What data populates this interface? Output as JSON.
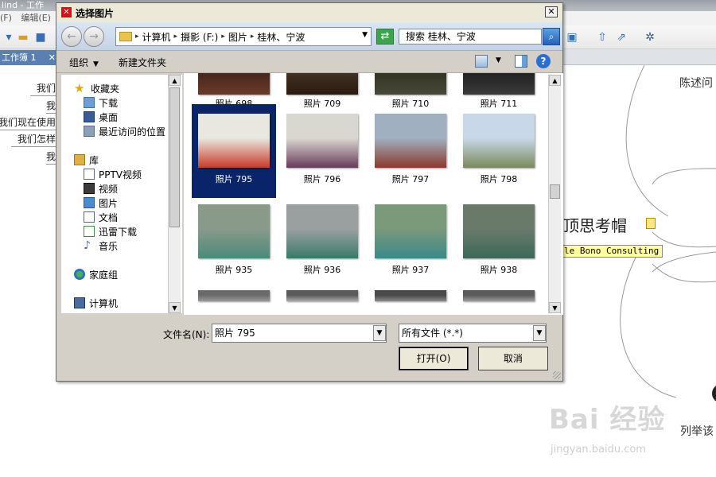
{
  "background_app": {
    "title": "lind - 工作",
    "menu": [
      "(F)",
      "编辑(E)"
    ],
    "tab_label": "工作簿 1",
    "left_topics": [
      "我们",
      "我",
      "我们现在使用",
      "我们怎样",
      "我"
    ],
    "right_topic_top": "陈述问",
    "central_topic": "顶思考帽",
    "tooltip": "le Bono Consulting",
    "right_topic_bottom": "列举该"
  },
  "watermark": {
    "brand": "Bai 经验",
    "url": "jingyan.baidu.com"
  },
  "dialog": {
    "title": "选择图片",
    "close_glyph": "✕",
    "address": {
      "segments": [
        "计算机",
        "摄影 (F:)",
        "图片",
        "桂林、宁波"
      ]
    },
    "search": {
      "placeholder": "搜索 桂林、宁波"
    },
    "commands": {
      "organize": "组织",
      "new_folder": "新建文件夹",
      "help_glyph": "?"
    },
    "nav_pane": {
      "favorites_header": "收藏夹",
      "favorites": [
        "下载",
        "桌面",
        "最近访问的位置"
      ],
      "libraries_header": "库",
      "libraries": [
        "PPTV视频",
        "视频",
        "图片",
        "文档",
        "迅雷下载",
        "音乐"
      ],
      "homegroup": "家庭组",
      "computer": "计算机"
    },
    "thumbnails": [
      {
        "label": "照片 698",
        "colors": [
          "#3a1f1a",
          "#6a3a28"
        ]
      },
      {
        "label": "照片 709",
        "colors": [
          "#4a3a2a",
          "#2a1a10"
        ]
      },
      {
        "label": "照片 710",
        "colors": [
          "#2a2a1a",
          "#4a4a3a"
        ]
      },
      {
        "label": "照片 711",
        "colors": [
          "#1a1a1a",
          "#3a3a3a"
        ]
      },
      {
        "label": "照片 795",
        "colors": [
          "#e8e8e0",
          "#c83a2a"
        ],
        "selected": true
      },
      {
        "label": "照片 796",
        "colors": [
          "#d8d8d0",
          "#6a3a5a"
        ]
      },
      {
        "label": "照片 797",
        "colors": [
          "#a0b0c0",
          "#8a3a2a"
        ]
      },
      {
        "label": "照片 798",
        "colors": [
          "#c8d8e8",
          "#7a8a5a"
        ]
      },
      {
        "label": "照片 935",
        "colors": [
          "#8a9a8a",
          "#4a8a7a"
        ]
      },
      {
        "label": "照片 936",
        "colors": [
          "#9aa0a0",
          "#3a7a6a"
        ]
      },
      {
        "label": "照片 937",
        "colors": [
          "#7a9a7a",
          "#3a8a8a"
        ]
      },
      {
        "label": "照片 938",
        "colors": [
          "#6a7a6a",
          "#3a6a5a"
        ]
      },
      {
        "label": "",
        "colors": [
          "#6a6a6a",
          "#9a9a9a"
        ]
      },
      {
        "label": "",
        "colors": [
          "#5a5a5a",
          "#aaaaaa"
        ]
      },
      {
        "label": "",
        "colors": [
          "#4a4a4a",
          "#8a8a8a"
        ]
      },
      {
        "label": "",
        "colors": [
          "#5a5a5a",
          "#9a9a9a"
        ]
      }
    ],
    "filename_label": "文件名(N):",
    "filename_value": "照片 795",
    "filter_value": "所有文件 (*.*)",
    "open_button": "打开(O)",
    "cancel_button": "取消"
  }
}
